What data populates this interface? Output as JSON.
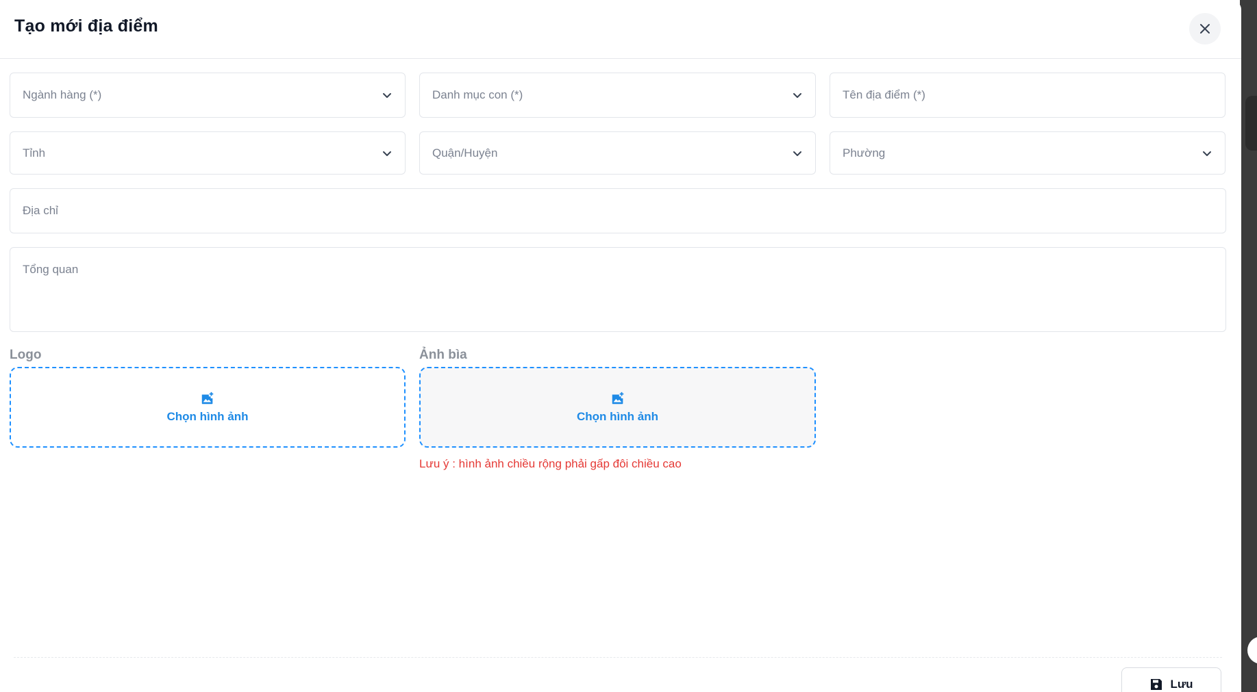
{
  "modal": {
    "title": "Tạo mới địa điểm",
    "close_icon": "close-icon"
  },
  "form": {
    "industry": {
      "placeholder": "Ngành hàng (*)",
      "icon": "chevron-down-icon"
    },
    "subcategory": {
      "placeholder": "Danh mục con (*)",
      "icon": "chevron-down-icon"
    },
    "place_name": {
      "placeholder": "Tên địa điểm (*)"
    },
    "province": {
      "placeholder": "Tỉnh",
      "icon": "chevron-down-icon"
    },
    "district": {
      "placeholder": "Quận/Huyện",
      "icon": "chevron-down-icon"
    },
    "ward": {
      "placeholder": "Phường",
      "icon": "chevron-down-icon"
    },
    "address": {
      "placeholder": "Địa chỉ"
    },
    "overview": {
      "placeholder": "Tổng quan"
    }
  },
  "uploads": {
    "logo": {
      "label": "Logo",
      "button": "Chọn hình ảnh",
      "icon": "add-photo-icon"
    },
    "cover": {
      "label": "Ảnh bìa",
      "button": "Chọn hình ảnh",
      "icon": "add-photo-icon"
    },
    "cover_note": "Lưu ý : hình ảnh chiều rộng phải gấp đôi chiều cao"
  },
  "footer": {
    "save_label": "Lưu",
    "save_icon": "save-icon"
  },
  "colors": {
    "accent": "#1e8ae6",
    "error": "#e53935",
    "border": "#e2e5ea",
    "placeholder": "#7b8290"
  }
}
